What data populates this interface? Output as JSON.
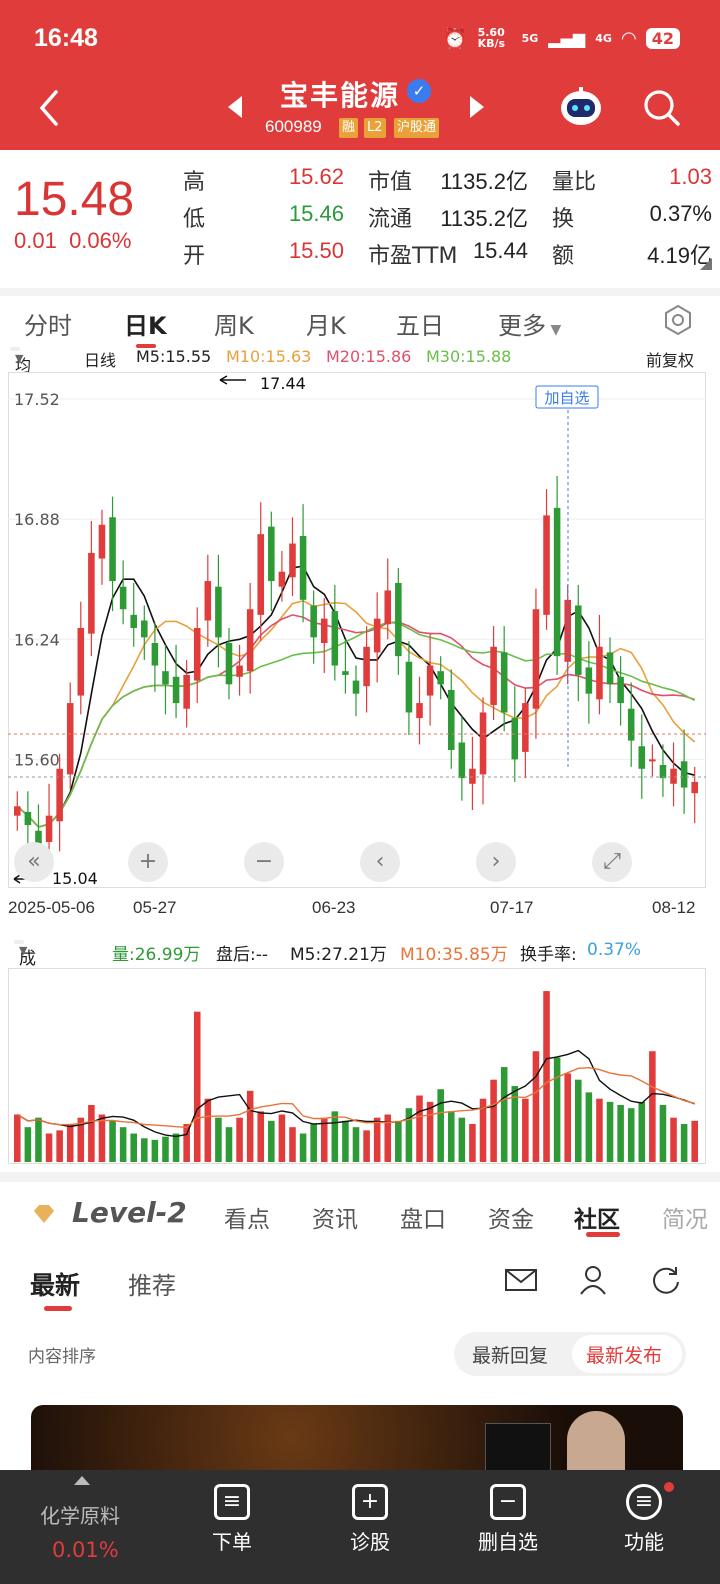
{
  "status": {
    "time": "16:48",
    "net_speed": "5.60 KB/s",
    "sig1": "5G",
    "sig2": "4G",
    "battery": "42"
  },
  "header": {
    "title": "宝丰能源",
    "code": "600989",
    "tags": [
      "融",
      "L2",
      "沪股通"
    ]
  },
  "quote": {
    "price": "15.48",
    "change": "0.01",
    "change_pct": "0.06%",
    "rows": [
      [
        {
          "label": "高",
          "value": "15.62",
          "color": "red"
        },
        {
          "label": "市值",
          "value": "1135.2亿",
          "color": "dark"
        },
        {
          "label": "量比",
          "value": "1.03",
          "color": "red"
        }
      ],
      [
        {
          "label": "低",
          "value": "15.46",
          "color": "green"
        },
        {
          "label": "流通",
          "value": "1135.2亿",
          "color": "dark"
        },
        {
          "label": "换",
          "value": "0.37%",
          "color": "dark"
        }
      ],
      [
        {
          "label": "开",
          "value": "15.50",
          "color": "red"
        },
        {
          "label": "市盈TTM",
          "value": "15.44",
          "color": "dark"
        },
        {
          "label": "额",
          "value": "4.19亿",
          "color": "dark"
        }
      ]
    ]
  },
  "tabs": [
    "分时",
    "日K",
    "周K",
    "月K",
    "五日",
    "更多"
  ],
  "ma": {
    "selector": "均线",
    "period": "日线",
    "m5": "M5:15.55",
    "m10": "M10:15.63",
    "m20": "M20:15.86",
    "m30": "M30:15.88",
    "adjust": "前复权"
  },
  "colors": {
    "up": "#e03c3b",
    "down": "#2e9a36",
    "m5": "#111111",
    "m10": "#e8a13a",
    "m20": "#e0506a",
    "m30": "#6abf4b"
  },
  "chart_data": {
    "type": "candlestick",
    "y_ticks": [
      "17.52",
      "16.88",
      "16.24",
      "15.60"
    ],
    "ylim": [
      15.0,
      17.6
    ],
    "max_label": "17.44",
    "min_label": "15.04",
    "add_watch": "加自选",
    "x_ticks": [
      "2025-05-06",
      "05-27",
      "06-23",
      "07-17",
      "08-12"
    ],
    "closes": [
      15.35,
      15.25,
      15.12,
      15.3,
      15.55,
      15.9,
      16.3,
      16.7,
      16.85,
      16.55,
      16.4,
      16.3,
      16.25,
      16.1,
      16.0,
      15.9,
      16.05,
      16.3,
      16.55,
      16.25,
      16.0,
      16.1,
      16.4,
      16.8,
      16.55,
      16.6,
      16.75,
      16.45,
      16.25,
      16.35,
      16.1,
      16.05,
      15.95,
      16.2,
      16.35,
      16.5,
      16.15,
      15.85,
      15.9,
      16.1,
      16.0,
      15.65,
      15.5,
      15.55,
      15.85,
      16.2,
      15.85,
      15.6,
      15.9,
      16.4,
      16.9,
      16.15,
      16.45,
      16.05,
      15.95,
      16.2,
      16.0,
      15.9,
      15.7,
      15.55,
      15.6,
      15.5,
      15.55,
      15.45,
      15.48
    ],
    "volume": {
      "label": "成交量",
      "vol": "量:26.99万",
      "after": "盘后:--",
      "m5": "M5:27.21万",
      "m10": "M10:35.85万",
      "turnover_label": "换手率:",
      "turnover": "0.37%",
      "values": [
        30,
        22,
        28,
        18,
        20,
        24,
        28,
        36,
        30,
        26,
        22,
        18,
        15,
        14,
        16,
        18,
        24,
        95,
        40,
        28,
        22,
        28,
        45,
        32,
        26,
        30,
        22,
        18,
        24,
        28,
        32,
        26,
        22,
        20,
        28,
        30,
        26,
        34,
        42,
        38,
        46,
        32,
        28,
        24,
        40,
        52,
        60,
        48,
        40,
        70,
        108,
        66,
        56,
        52,
        44,
        40,
        38,
        36,
        34,
        38,
        70,
        36,
        28,
        24,
        26
      ]
    }
  },
  "info_tabs": [
    "Level-2",
    "看点",
    "资讯",
    "盘口",
    "资金",
    "社区",
    "简况"
  ],
  "sub_tabs": [
    "最新",
    "推荐"
  ],
  "sort": {
    "label": "内容排序",
    "opt1": "最新回复",
    "opt2": "最新发布"
  },
  "bottom": {
    "sector": "化学原料",
    "sector_pct": "0.01%",
    "items": [
      "下单",
      "诊股",
      "删自选",
      "功能"
    ]
  }
}
